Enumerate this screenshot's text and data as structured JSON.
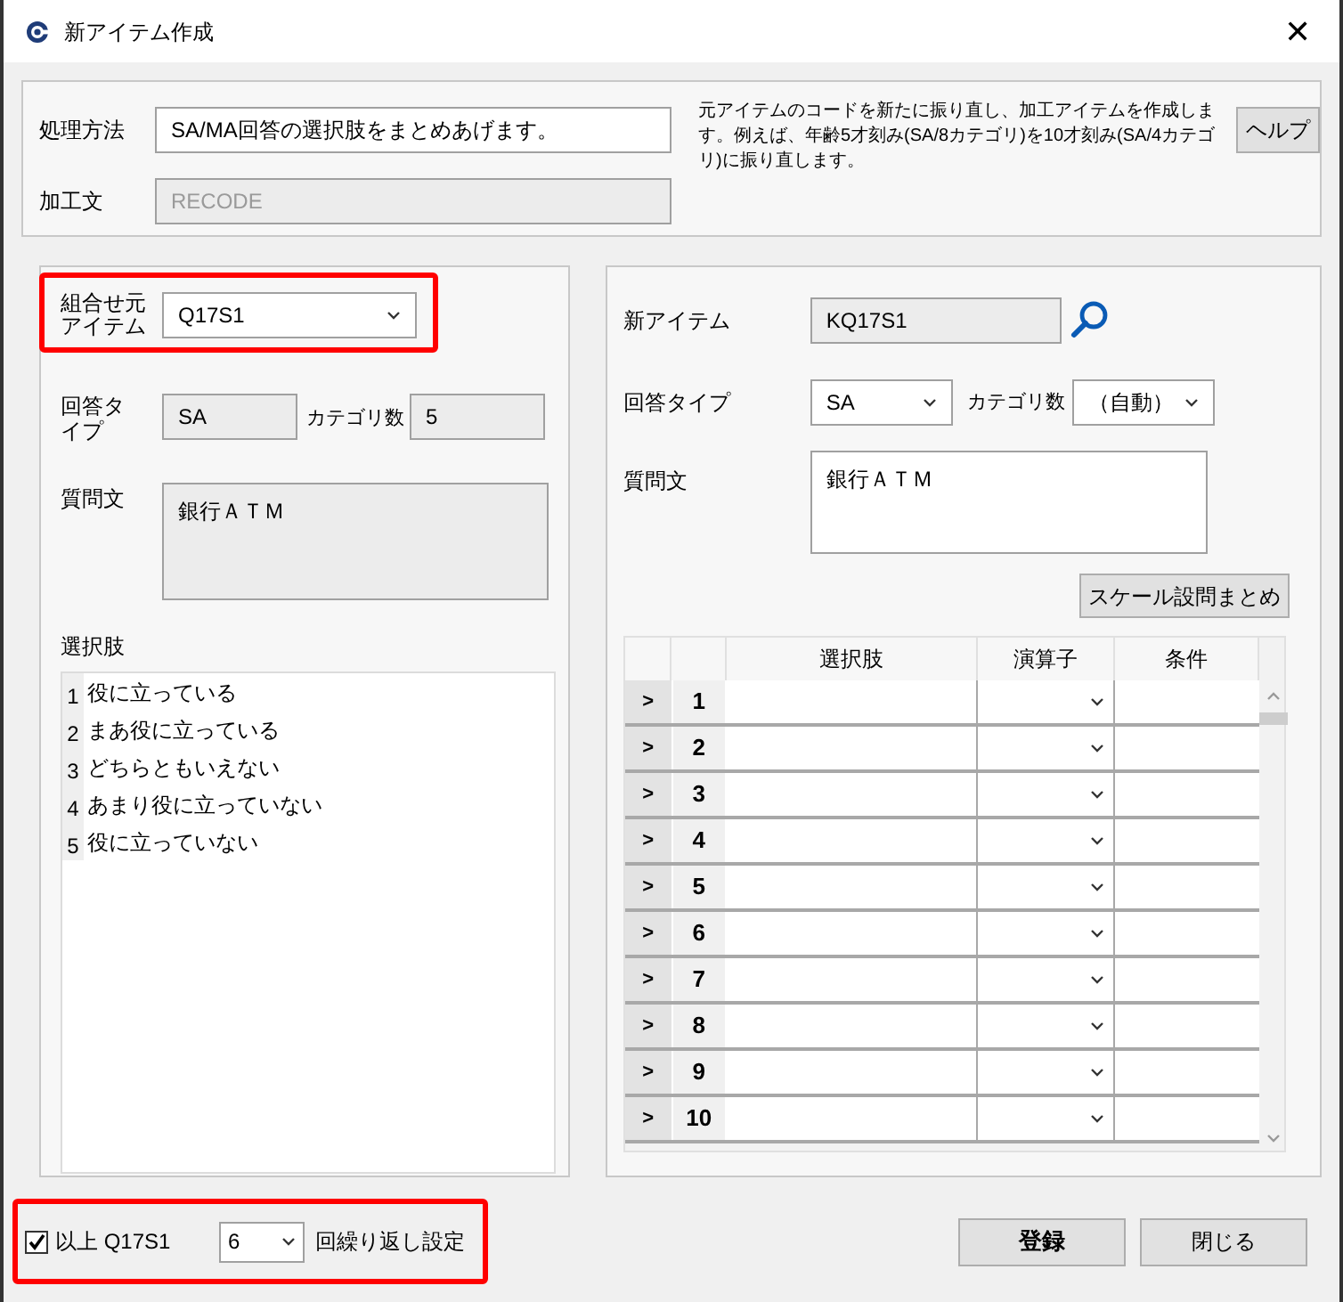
{
  "window": {
    "title": "新アイテム作成",
    "close": "✕"
  },
  "method": {
    "label": "処理方法",
    "value": "SA/MA回答の選択肢をまとめあげます。",
    "description": "元アイテムのコードを新たに振り直し、加工アイテムを作成します。例えば、年齢5才刻み(SA/8カテゴリ)を10才刻み(SA/4カテゴリ)に振り直します。",
    "help_button": "ヘルプ"
  },
  "processing": {
    "label": "加工文",
    "value": "RECODE",
    "disabled": true
  },
  "source": {
    "item_label": "組合せ元アイテム",
    "item_value": "Q17S1",
    "type_label": "回答タイプ",
    "type_value": "SA",
    "count_label": "カテゴリ数",
    "count_value": "5",
    "question_label": "質問文",
    "question_value": "銀行ＡＴＭ",
    "choices_label": "選択肢",
    "choices": [
      {
        "number": "1",
        "text": "役に立っている"
      },
      {
        "number": "2",
        "text": "まあ役に立っている"
      },
      {
        "number": "3",
        "text": "どちらともいえない"
      },
      {
        "number": "4",
        "text": "あまり役に立っていない"
      },
      {
        "number": "5",
        "text": "役に立っていない"
      }
    ]
  },
  "target": {
    "item_label": "新アイテム",
    "item_value": "KQ17S1",
    "type_label": "回答タイプ",
    "type_value": "SA",
    "count_label": "カテゴリ数",
    "count_value": "（自動）",
    "question_label": "質問文",
    "question_value": "銀行ＡＴＭ",
    "scale_button": "スケール設問まとめ",
    "table": {
      "columns": [
        "選択肢",
        "演算子",
        "条件"
      ],
      "rows": [
        {
          "marker": ">",
          "number": "1"
        },
        {
          "marker": ">",
          "number": "2"
        },
        {
          "marker": ">",
          "number": "3"
        },
        {
          "marker": ">",
          "number": "4"
        },
        {
          "marker": ">",
          "number": "5"
        },
        {
          "marker": ">",
          "number": "6"
        },
        {
          "marker": ">",
          "number": "7"
        },
        {
          "marker": ">",
          "number": "8"
        },
        {
          "marker": ">",
          "number": "9"
        },
        {
          "marker": ">",
          "number": "10"
        }
      ]
    }
  },
  "footer": {
    "repeat_checked": true,
    "repeat_label": "以上 Q17S1",
    "repeat_count": "6",
    "repeat_suffix": "回繰り返し設定",
    "register_button": "登録",
    "close_button": "閉じる"
  }
}
